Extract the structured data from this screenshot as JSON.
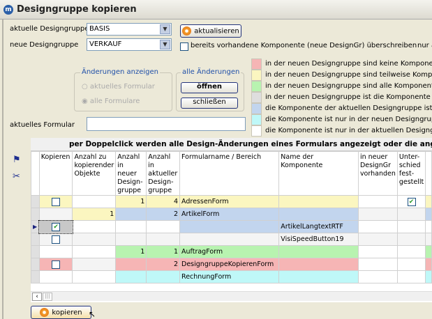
{
  "window": {
    "title": "Designgruppe kopieren",
    "logo": "m"
  },
  "form": {
    "aktuelle_label": "aktuelle Designgruppe",
    "aktuelle_value": "BASIS",
    "neue_label": "neue Designgruppe",
    "neue_value": "VERKAUF",
    "aktualisieren": "aktualisieren",
    "overwrite_label": "bereits vorhandene Komponente (neue DesignGr) überschreiben",
    "overwrite_checked": false,
    "nur_label": "nur a",
    "aktuelles_formular_label": "aktuelles Formular",
    "aktuelles_formular_value": ""
  },
  "aenderungen_anzeigen": {
    "caption": "Änderungen anzeigen",
    "opt1": "aktuelles Formular",
    "opt2": "alle Formulare",
    "selected": "alle Formulare"
  },
  "alle_aenderungen": {
    "caption": "alle Änderungen",
    "open": "öffnen",
    "close": "schließen"
  },
  "legend": [
    {
      "color": "#f6b5b5",
      "text": "in der neuen Designgruppe sind keine Komponente"
    },
    {
      "color": "#fbf6c0",
      "text": "in der neuen Designgruppe sind teilweise Kompone"
    },
    {
      "color": "#b8f3b0",
      "text": "in der neuen Designgruppe sind alle Komponenten"
    },
    {
      "color": "#dedede",
      "text": "in der neuen Designgruppe ist die Komponente der"
    },
    {
      "color": "#c2d5ee",
      "text": "die Komponente der aktuellen Designgruppe ist au"
    },
    {
      "color": "#bff8f8",
      "text": "die Komponente ist nur in der neuen Designgruppe"
    },
    {
      "color": "#ffffff",
      "text": "die Komponente ist nur in der aktuellen Designgrup"
    }
  ],
  "grid": {
    "banner": "per Doppelclick werden alle Design-Änderungen eines Formulars angezeigt oder die angezeig",
    "columns": [
      "Kopieren",
      "Anzahl zu kopierender Objekte",
      "Anzahl in neuer Design-gruppe",
      "Anzahl in aktueller Design-gruppe",
      "Formularname / Bereich",
      "Name der Komponente",
      "in neuer DesignGr vorhanden",
      "Unter-schied fest-gestellt"
    ],
    "rows": [
      {
        "kopieren": "unchecked",
        "anzahl_zu": "",
        "neu": "1",
        "akt": "4",
        "form": "AdressenForm",
        "komp": "",
        "vorh": "",
        "unterschied": "checked"
      },
      {
        "kopieren": "",
        "anzahl_zu": "1",
        "neu": "",
        "akt": "2",
        "form": "ArtikelForm",
        "komp": "",
        "vorh": "",
        "unterschied": ""
      },
      {
        "kopieren": "checked",
        "anzahl_zu": "",
        "neu": "",
        "akt": "",
        "form": "",
        "komp": "ArtikelLangtextRTF",
        "vorh": "",
        "unterschied": "",
        "selected": true
      },
      {
        "kopieren": "unchecked",
        "anzahl_zu": "",
        "neu": "",
        "akt": "",
        "form": "",
        "komp": "VisiSpeedButton19",
        "vorh": "",
        "unterschied": ""
      },
      {
        "kopieren": "",
        "anzahl_zu": "",
        "neu": "1",
        "akt": "1",
        "form": "AuftragForm",
        "komp": "",
        "vorh": "",
        "unterschied": ""
      },
      {
        "kopieren": "unchecked",
        "anzahl_zu": "",
        "neu": "",
        "akt": "2",
        "form": "DesigngruppeKopierenForm",
        "komp": "",
        "vorh": "",
        "unterschied": ""
      },
      {
        "kopieren": "",
        "anzahl_zu": "",
        "neu": "",
        "akt": "",
        "form": "RechnungForm",
        "komp": "",
        "vorh": "",
        "unterschied": ""
      }
    ]
  },
  "side_icons": [
    "flag-icon",
    "scissors-icon"
  ],
  "kopieren_button": "kopieren"
}
